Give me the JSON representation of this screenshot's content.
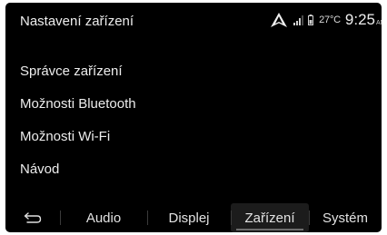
{
  "header": {
    "title": "Nastavení zařízení",
    "temperature": "27°C",
    "time": "9:25",
    "time_suffix": "AM",
    "icons": [
      "navigation-icon",
      "signal-icon",
      "battery-icon"
    ]
  },
  "menu": {
    "items": [
      {
        "label": "Správce zařízení"
      },
      {
        "label": "Možnosti Bluetooth"
      },
      {
        "label": "Možnosti Wi-Fi"
      },
      {
        "label": "Návod"
      }
    ]
  },
  "tabs": {
    "back_icon": "back-arrow-icon",
    "items": [
      {
        "label": "Audio"
      },
      {
        "label": "Displej"
      },
      {
        "label": "Zařízení",
        "active": true
      },
      {
        "label": "Systém"
      }
    ]
  }
}
